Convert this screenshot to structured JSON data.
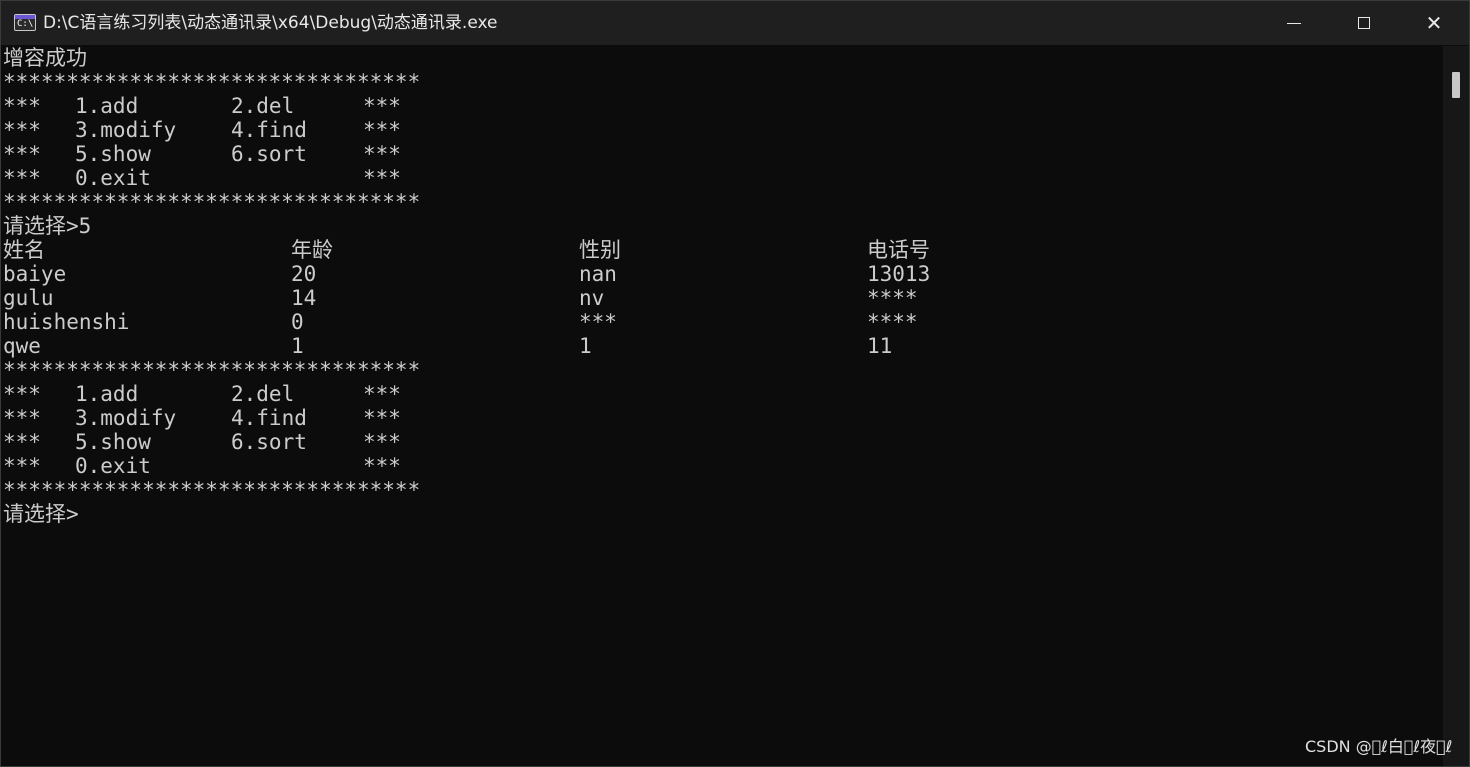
{
  "window": {
    "title": "D:\\C语言练习列表\\动态通讯录\\x64\\Debug\\动态通讯录.exe",
    "icon_label": "C:\\",
    "minimize_icon": "minimize-icon",
    "maximize_icon": "maximize-icon",
    "close_icon": "close-icon",
    "close_glyph": "✕"
  },
  "console": {
    "status": "增容成功",
    "menu1": {
      "border_top": "*********************************",
      "rows": [
        {
          "left": "***",
          "a": "1.add",
          "b": "2.del",
          "right": "***"
        },
        {
          "left": "***",
          "a": "3.modify",
          "b": "4.find",
          "right": "***"
        },
        {
          "left": "***",
          "a": "5.show",
          "b": "6.sort",
          "right": "***"
        },
        {
          "left": "***",
          "a": "0.exit",
          "b": "",
          "right": "***"
        }
      ],
      "border_bottom": "*********************************"
    },
    "prompt1": "请选择>5",
    "table": {
      "headers": [
        "姓名",
        "年龄",
        "性别",
        "电话号"
      ],
      "rows": [
        [
          "baiye",
          "20",
          "nan",
          "13013"
        ],
        [
          "gulu",
          "14",
          "nv",
          "****"
        ],
        [
          "huishenshi",
          "0",
          "***",
          "****"
        ],
        [
          "qwe",
          "1",
          "1",
          "11"
        ]
      ]
    },
    "menu2": {
      "border_top": "*********************************",
      "rows": [
        {
          "left": "***",
          "a": "1.add",
          "b": "2.del",
          "right": "***"
        },
        {
          "left": "***",
          "a": "3.modify",
          "b": "4.find",
          "right": "***"
        },
        {
          "left": "***",
          "a": "5.show",
          "b": "6.sort",
          "right": "***"
        },
        {
          "left": "***",
          "a": "0.exit",
          "b": "",
          "right": "***"
        }
      ],
      "border_bottom": "*********************************"
    },
    "prompt2": "请选择>"
  },
  "watermark": "CSDN @\u0000ℓ白\u0000ℓ夜\u0000ℓ",
  "colors": {
    "console_bg": "#0c0c0c",
    "console_text": "#cccccc",
    "titlebar_bg": "#1f1f1f",
    "icon_accent": "#6b57d6"
  }
}
